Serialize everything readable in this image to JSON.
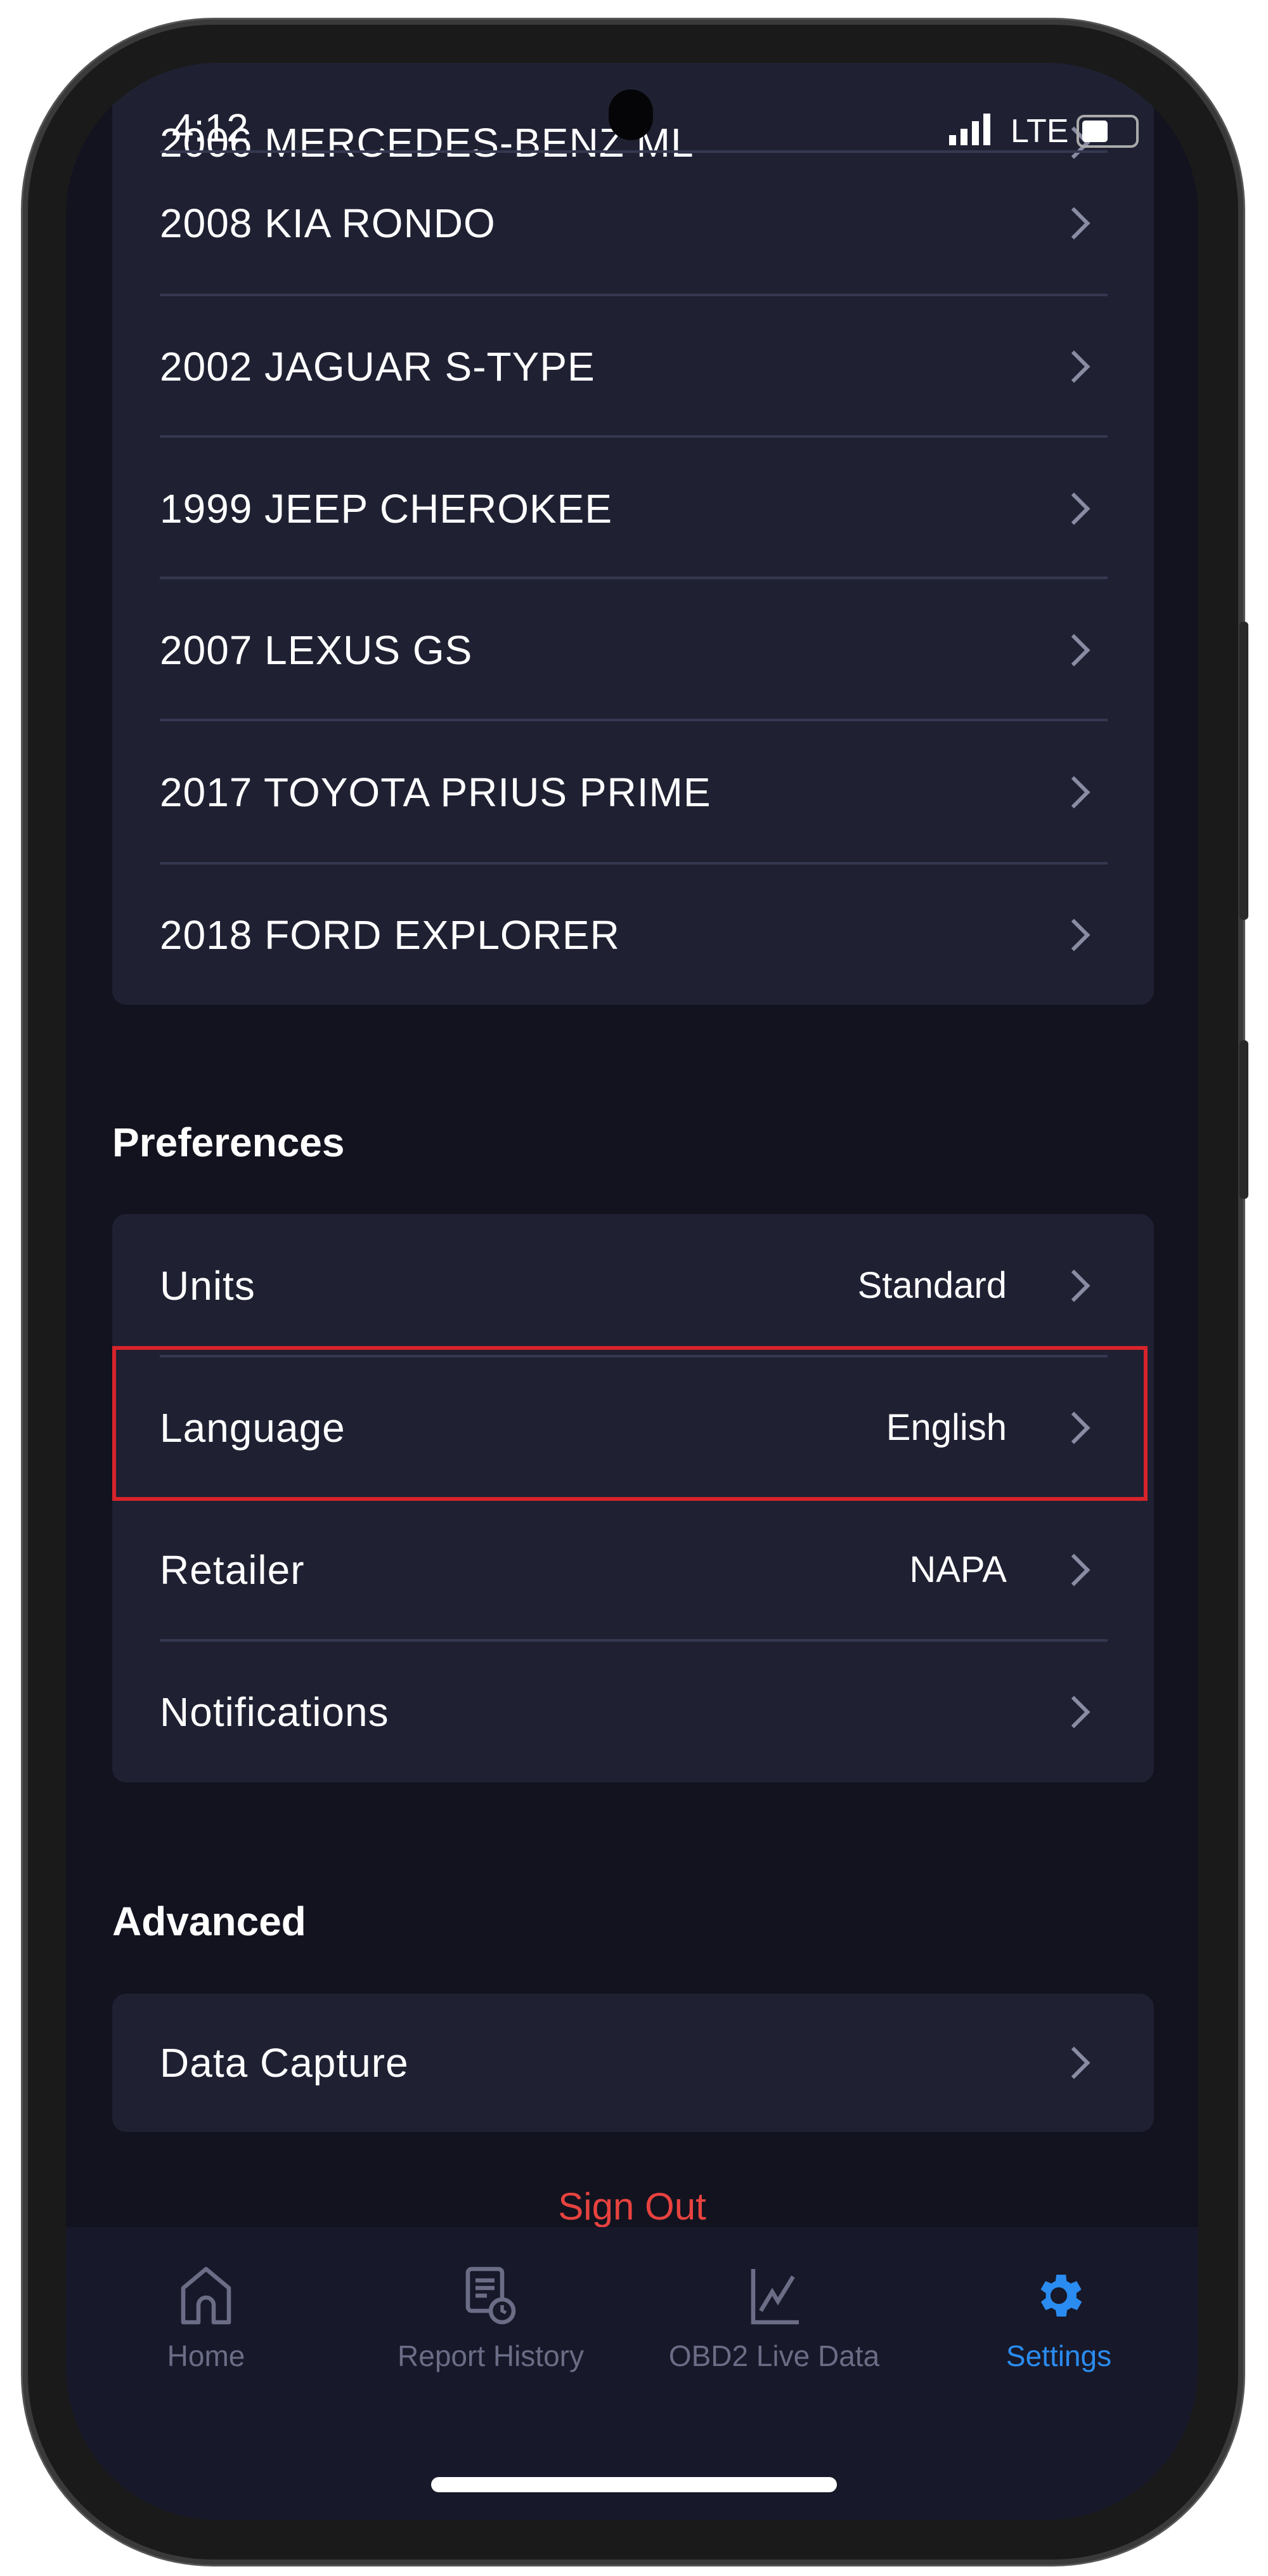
{
  "status_bar": {
    "time": "4:12",
    "network": "LTE",
    "icons": [
      "signal-icon",
      "battery-icon"
    ]
  },
  "vehicles": [
    {
      "label": "2006 MERCEDES-BENZ ML"
    },
    {
      "label": "2008 KIA RONDO"
    },
    {
      "label": "2002 JAGUAR S-TYPE"
    },
    {
      "label": "1999 JEEP CHEROKEE"
    },
    {
      "label": "2007 LEXUS GS"
    },
    {
      "label": "2017 TOYOTA PRIUS PRIME"
    },
    {
      "label": "2018 FORD EXPLORER"
    }
  ],
  "preferences": {
    "heading": "Preferences",
    "items": [
      {
        "label": "Units",
        "value": "Standard"
      },
      {
        "label": "Language",
        "value": "English",
        "highlighted": true
      },
      {
        "label": "Retailer",
        "value": "NAPA"
      },
      {
        "label": "Notifications",
        "value": ""
      }
    ]
  },
  "advanced": {
    "heading": "Advanced",
    "items": [
      {
        "label": "Data Capture"
      }
    ]
  },
  "sign_out": "Sign Out",
  "nav": {
    "items": [
      {
        "label": "Home",
        "icon": "home-icon"
      },
      {
        "label": "Report History",
        "icon": "report-history-icon"
      },
      {
        "label": "OBD2 Live Data",
        "icon": "chart-line-icon"
      },
      {
        "label": "Settings",
        "icon": "gear-icon",
        "active": true
      }
    ]
  },
  "colors": {
    "accent": "#2a8cf0",
    "danger": "#e8423f",
    "highlight": "#d8232a",
    "background": "#12131f",
    "card": "#1f2133"
  }
}
